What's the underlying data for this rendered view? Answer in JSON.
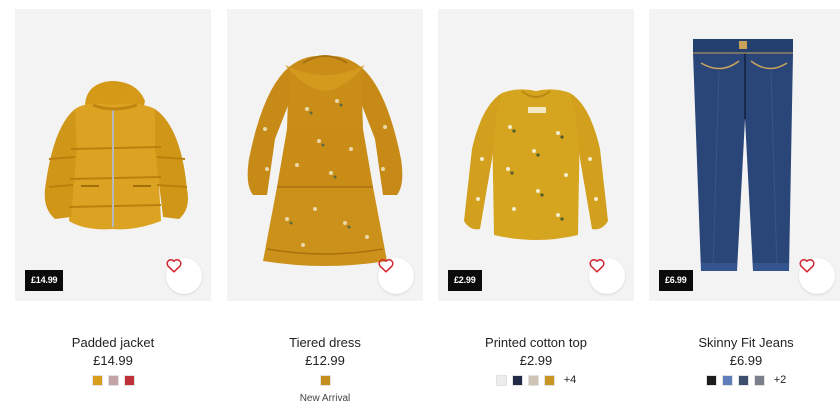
{
  "products": [
    {
      "name": "Padded jacket",
      "price": "£14.99",
      "tag": "£14.99",
      "colors": [
        "#d99e1d",
        "#c3a4a6",
        "#c0303b"
      ],
      "more": "",
      "badge": "",
      "favorite_icon": "heart-icon"
    },
    {
      "name": "Tiered dress",
      "price": "£12.99",
      "tag": "",
      "colors": [
        "#c58f1f"
      ],
      "more": "",
      "badge": "New Arrival",
      "favorite_icon": "heart-icon"
    },
    {
      "name": "Printed cotton top",
      "price": "£2.99",
      "tag": "£2.99",
      "colors": [
        "#ededed",
        "#232a45",
        "#cfc5b6",
        "#c69522"
      ],
      "more": "+4",
      "badge": "",
      "favorite_icon": "heart-icon"
    },
    {
      "name": "Skinny Fit Jeans",
      "price": "£6.99",
      "tag": "£6.99",
      "colors": [
        "#1c1c1c",
        "#5f7db8",
        "#3d4e6e",
        "#7a7f8b"
      ],
      "more": "+2",
      "badge": "",
      "favorite_icon": "heart-icon"
    }
  ],
  "theme": {
    "heart_color": "#d1242f",
    "mustard": "#d6a21f",
    "denim": "#2a4476"
  }
}
